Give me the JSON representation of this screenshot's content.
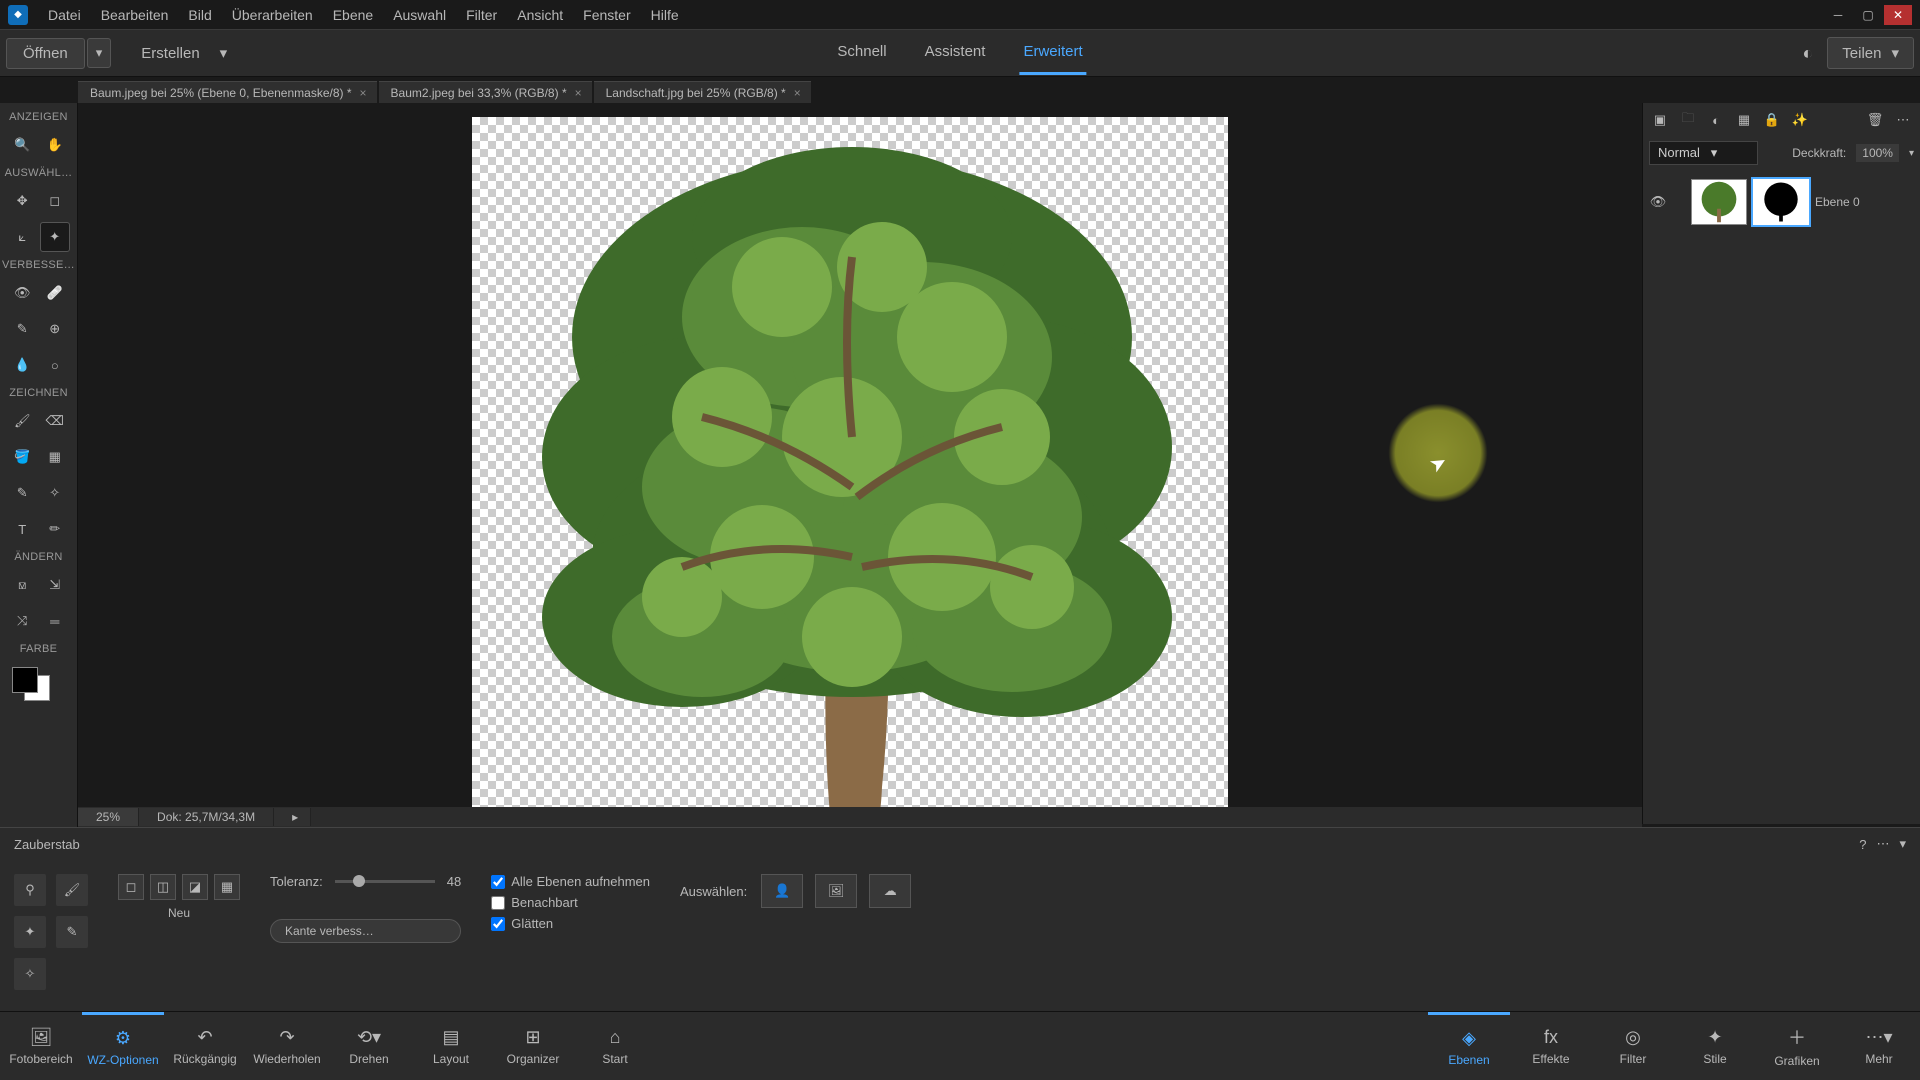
{
  "menubar": {
    "items": [
      "Datei",
      "Bearbeiten",
      "Bild",
      "Überarbeiten",
      "Ebene",
      "Auswahl",
      "Filter",
      "Ansicht",
      "Fenster",
      "Hilfe"
    ]
  },
  "actionbar": {
    "open_label": "Öffnen",
    "create_label": "Erstellen",
    "modes": [
      "Schnell",
      "Assistent",
      "Erweitert"
    ],
    "active_mode": 2,
    "share_label": "Teilen"
  },
  "doctabs": [
    {
      "title": "Baum.jpeg bei 25% (Ebene 0, Ebenenmaske/8) *"
    },
    {
      "title": "Baum2.jpeg bei 33,3% (RGB/8) *"
    },
    {
      "title": "Landschaft.jpg bei 25% (RGB/8) *"
    }
  ],
  "left_toolbar": {
    "sections": {
      "anzeigen": "ANZEIGEN",
      "auswahl": "AUSWÄHL…",
      "verbessern": "VERBESSE…",
      "zeichnen": "ZEICHNEN",
      "aendern": "ÄNDERN",
      "farbe": "FARBE"
    }
  },
  "status": {
    "zoom": "25%",
    "doc_info": "Dok: 25,7M/34,3M"
  },
  "tool_options": {
    "tool_name": "Zauberstab",
    "neu_label": "Neu",
    "toleranz_label": "Toleranz:",
    "toleranz_value": "48",
    "kante_label": "Kante verbess…",
    "alle_ebenen": "Alle Ebenen aufnehmen",
    "benachbart": "Benachbart",
    "glaetten": "Glätten",
    "auswaehlen_label": "Auswählen:",
    "alle_ebenen_checked": true,
    "benachbart_checked": false,
    "glaetten_checked": true
  },
  "layers": {
    "blend_mode": "Normal",
    "opacity_label": "Deckkraft:",
    "opacity_value": "100%",
    "layer0_name": "Ebene 0"
  },
  "bottom_bar": {
    "left_items": [
      "Fotobereich",
      "WZ-Optionen",
      "Rückgängig",
      "Wiederholen",
      "Drehen",
      "Layout",
      "Organizer",
      "Start"
    ],
    "left_active": 1,
    "right_items": [
      "Ebenen",
      "Effekte",
      "Filter",
      "Stile",
      "Grafiken",
      "Mehr"
    ],
    "right_active": 0
  },
  "colors": {
    "accent": "#4aa8ff",
    "highlight_circle": "#8a8f2d"
  }
}
